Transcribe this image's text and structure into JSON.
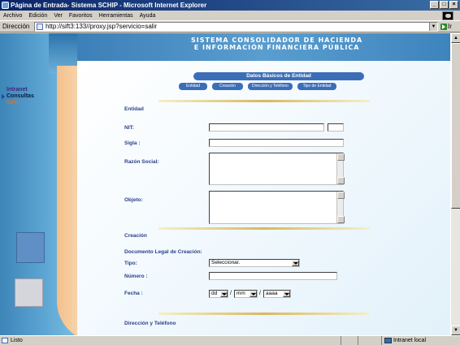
{
  "window": {
    "title": "Página de Entrada- Sistema SCHIP - Microsoft Internet Explorer",
    "controls": [
      "_",
      "□",
      "×"
    ]
  },
  "menu": [
    "Archivo",
    "Edición",
    "Ver",
    "Favoritos",
    "Herramientas",
    "Ayuda"
  ],
  "address": {
    "label": "Dirección",
    "url": "http://sift3:133//proxy.jsp?servicio=salir",
    "go_label": "Ir"
  },
  "banner": {
    "line1": "SISTEMA CONSOLIDADOR DE HACIENDA",
    "line2": "E INFORMACIÓN FINANCIERA PÚBLICA"
  },
  "sidebar": {
    "links": [
      {
        "label": "Intranet"
      },
      {
        "label": "Consultas"
      },
      {
        "label": "Salir"
      }
    ]
  },
  "form": {
    "section_title": "Datos Básicos de Entidad",
    "tabs": [
      "Entidad",
      "Creación",
      "Dirección y Teléfono",
      "Tipo de Entidad"
    ],
    "entidad_heading": "Entidad",
    "nit_label": "NIT:",
    "sigla_label": "Sigla :",
    "razon_label": "Razón Social:",
    "objeto_label": "Objeto:",
    "creacion_heading": "Creación",
    "documento_label": "Documento Legal de Creación:",
    "tipo_label": "Tipo:",
    "tipo_value": "Seleccionar.",
    "numero_label": "Número :",
    "fecha_label": "Fecha :",
    "fecha_dd": "dd",
    "fecha_mm": "mm",
    "fecha_aaaa": "aaaa",
    "fecha_sep": "/",
    "direccion_heading": "Dirección y Teléfono"
  },
  "status": {
    "left": "Listo",
    "zone": "Intranet local"
  }
}
